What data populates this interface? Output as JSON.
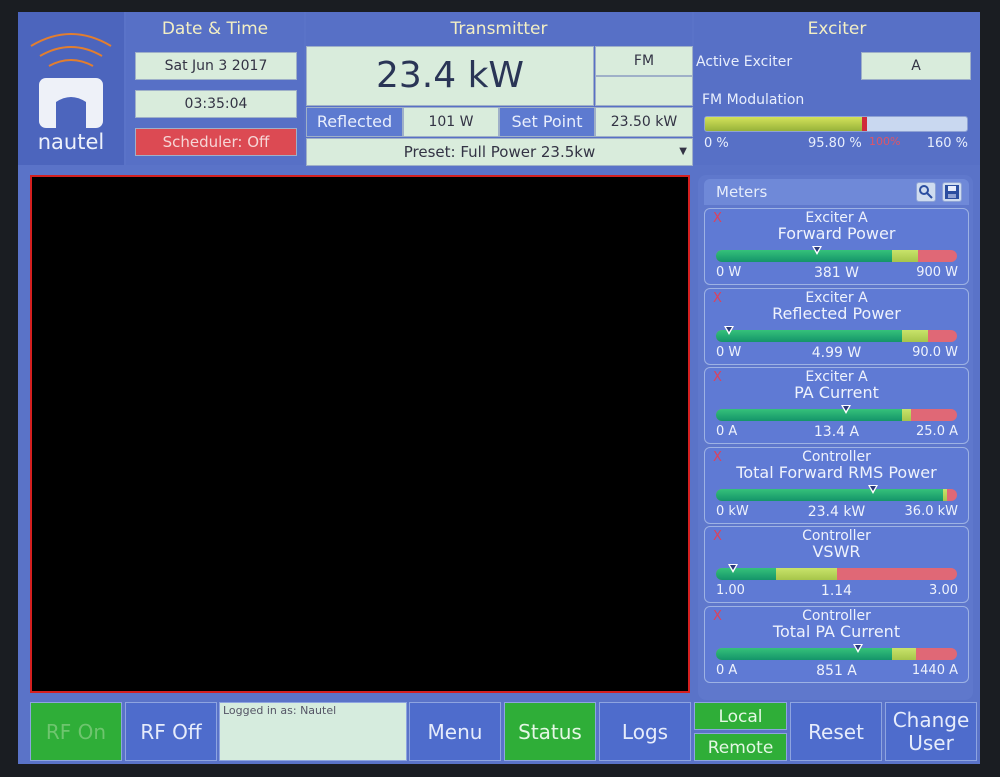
{
  "header": {
    "brand": "nautel",
    "datetime": {
      "title": "Date & Time",
      "date": "Sat Jun 3 2017",
      "time": "03:35:04",
      "scheduler": "Scheduler: Off"
    },
    "transmitter": {
      "title": "Transmitter",
      "power": "23.4 kW",
      "mode": "FM",
      "reflected_label": "Reflected",
      "reflected_value": "101 W",
      "setpoint_label": "Set Point",
      "setpoint_value": "23.50 kW",
      "preset": "Preset: Full Power 23.5kw"
    },
    "exciter": {
      "title": "Exciter",
      "active_label": "Active Exciter",
      "active_value": "A",
      "modulation_label": "FM Modulation",
      "modulation_fraction": 0.6,
      "scale_min": "0 %",
      "scale_value": "95.80 %",
      "scale_mark": "100%",
      "scale_max": "160 %"
    }
  },
  "meters": {
    "title": "Meters",
    "items": [
      {
        "line1": "Exciter A",
        "line2": "Forward Power",
        "min": "0 W",
        "value": "381 W",
        "max": "900 W",
        "fraction": 0.42,
        "green_end": 0.73,
        "yellow_end": 0.84
      },
      {
        "line1": "Exciter A",
        "line2": "Reflected Power",
        "min": "0 W",
        "value": "4.99 W",
        "max": "90.0 W",
        "fraction": 0.055,
        "green_end": 0.77,
        "yellow_end": 0.88
      },
      {
        "line1": "Exciter A",
        "line2": "PA Current",
        "min": "0 A",
        "value": "13.4 A",
        "max": "25.0 A",
        "fraction": 0.54,
        "green_end": 0.77,
        "yellow_end": 0.81
      },
      {
        "line1": "Controller",
        "line2": "Total Forward RMS Power",
        "min": "0 kW",
        "value": "23.4 kW",
        "max": "36.0 kW",
        "fraction": 0.65,
        "green_end": 0.94,
        "yellow_end": 0.96
      },
      {
        "line1": "Controller",
        "line2": "VSWR",
        "min": "1.00",
        "value": "1.14",
        "max": "3.00",
        "fraction": 0.07,
        "green_end": 0.25,
        "yellow_end": 0.5
      },
      {
        "line1": "Controller",
        "line2": "Total PA Current",
        "min": "0 A",
        "value": "851 A",
        "max": "1440 A",
        "fraction": 0.59,
        "green_end": 0.73,
        "yellow_end": 0.83
      }
    ]
  },
  "bottom": {
    "rf_on": "RF On",
    "rf_off": "RF Off",
    "logged_in": "Logged in as: Nautel",
    "menu": "Menu",
    "status": "Status",
    "logs": "Logs",
    "local": "Local",
    "remote": "Remote",
    "reset": "Reset",
    "change_user_1": "Change",
    "change_user_2": "User"
  },
  "colors": {
    "accent": "#5a73c8",
    "on_green": "#2fae38",
    "alarm_red": "#dc4a53"
  }
}
